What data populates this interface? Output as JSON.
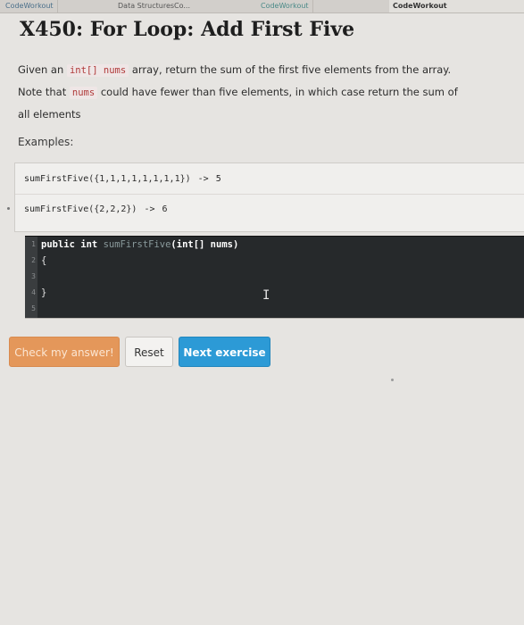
{
  "tabs": [
    {
      "label": "CodeWorkout"
    },
    {
      "label": "Data StructuresCo..."
    },
    {
      "label": "CodeWorkout"
    },
    {
      "label": "CodeWorkout"
    }
  ],
  "exercise": {
    "title": "X450: For Loop: Add First Five",
    "desc": {
      "part1": "Given an",
      "code1": "int[] nums",
      "part2": "array, return the sum of the first five elements from the array.",
      "part3": "Note that",
      "code2": "nums",
      "part4": "could have fewer than five elements, in which case return the sum of",
      "part5": "all elements"
    },
    "examples_label": "Examples:",
    "examples": [
      {
        "call": "sumFirstFive({1,1,1,1,1,1,1,1})",
        "arrow": "->",
        "result": "5"
      },
      {
        "call": "sumFirstFive({2,2,2})",
        "arrow": "->",
        "result": "6"
      }
    ]
  },
  "editor": {
    "line_numbers": [
      "1",
      "2",
      "3",
      "4",
      "5"
    ],
    "line1": {
      "kw1": "public",
      "kw2": "int",
      "fn": "sumFirstFive",
      "rest": "(int[] nums)"
    },
    "line2": "{",
    "line4": "}",
    "cursor": "I"
  },
  "buttons": {
    "check": "Check my answer!",
    "reset": "Reset",
    "next": "Next exercise"
  },
  "colors": {
    "check_button": "#e4975a",
    "next_button": "#2c9ad6",
    "editor_bg": "#26292b",
    "inline_code": "#b03a3a"
  }
}
